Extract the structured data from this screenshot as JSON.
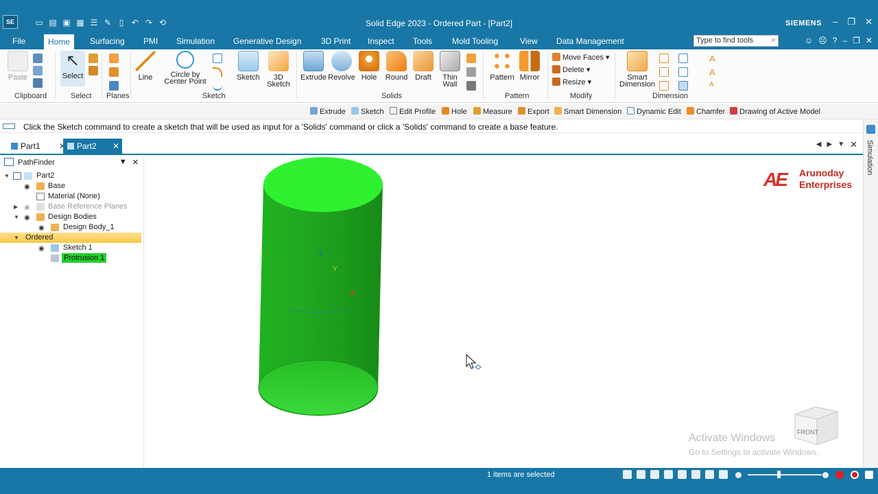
{
  "window": {
    "title": "Solid Edge 2023 - Ordered Part - [Part2]",
    "app_badge": "SE",
    "brand": "SIEMENS"
  },
  "menu": {
    "tabs": [
      "File",
      "Home",
      "Surfacing",
      "PMI",
      "Simulation",
      "Generative Design",
      "3D Print",
      "Inspect",
      "Tools",
      "Mold Tooling",
      "View",
      "Data Management"
    ],
    "active": "Home",
    "search_placeholder": "Type to find tools"
  },
  "ribbon": {
    "clipboard": {
      "paste": "Paste",
      "group": "Clipboard"
    },
    "select": {
      "select": "Select",
      "group": "Select"
    },
    "planes": {
      "group": "Planes"
    },
    "sketch": {
      "line": "Line",
      "circle": "Circle by",
      "circle2": "Center Point",
      "group": "Sketch"
    },
    "sketch2": {
      "sketch": "Sketch",
      "sketch3d": "3D",
      "sketch3d2": "Sketch"
    },
    "solids": {
      "extrude": "Extrude",
      "revolve": "Revolve",
      "hole": "Hole",
      "round": "Round",
      "draft": "Draft",
      "thin": "Thin",
      "thin2": "Wall",
      "group": "Solids"
    },
    "pattern": {
      "pattern": "Pattern",
      "mirror": "Mirror",
      "group": "Pattern"
    },
    "modify": {
      "move_faces": "Move Faces",
      "delete": "Delete",
      "resize": "Resize",
      "group": "Modify"
    },
    "dimension": {
      "smart": "Smart",
      "smart2": "Dimension",
      "group": "Dimension"
    }
  },
  "command_bar": [
    "Extrude",
    "Sketch",
    "Edit Profile",
    "Hole",
    "Measure",
    "Export",
    "Smart Dimension",
    "Dynamic Edit",
    "Chamfer",
    "Drawing of Active Model"
  ],
  "prompt": "Click the Sketch command to create a sketch that will be used as input for a 'Solids' command or click a 'Solids' command to create a base feature.",
  "doc_tabs": [
    "Part1",
    "Part2"
  ],
  "active_doc": "Part2",
  "right_strip": "Simulation",
  "pathfinder": {
    "title": "PathFinder",
    "tree": [
      "Part2",
      "Base",
      "Material (None)",
      "Base Reference Planes",
      "Design Bodies",
      "Design Body_1",
      "Ordered",
      "Sketch 1",
      "Protrusion 1"
    ]
  },
  "viewport": {
    "logo_text_1": "Arunoday",
    "logo_text_2": "Enterprises",
    "axis_z": "Z",
    "axis_y": "Y",
    "view_cube_label": "FRONT",
    "watermark_1": "Activate Windows",
    "watermark_2": "Go to Settings to activate Windows.",
    "body_color": "#22c522"
  },
  "status": {
    "selection": "1 items are selected"
  }
}
